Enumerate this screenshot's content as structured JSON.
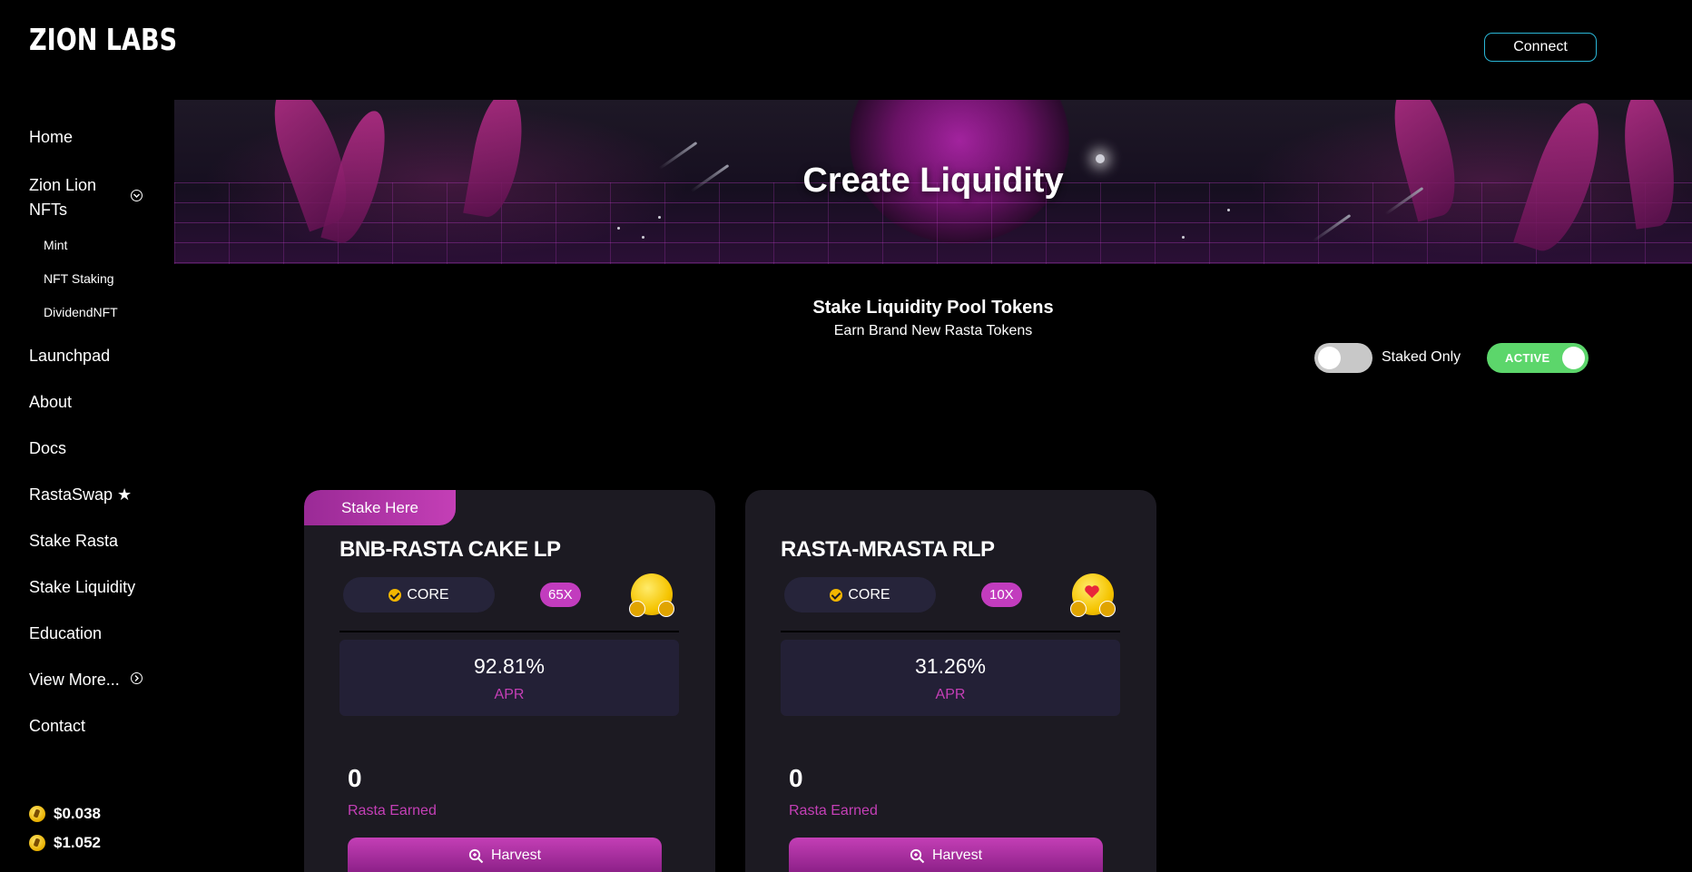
{
  "brand": "ZION LABS",
  "connect_label": "Connect",
  "sidebar": {
    "items": [
      {
        "label": "Home"
      },
      {
        "label": "Zion Lion NFTs",
        "line1": "Zion Lion",
        "line2": "NFTs"
      },
      {
        "label": "Mint"
      },
      {
        "label": "NFT Staking"
      },
      {
        "label": "DividendNFT"
      },
      {
        "label": "Launchpad"
      },
      {
        "label": "About"
      },
      {
        "label": "Docs"
      },
      {
        "label": "RastaSwap ★"
      },
      {
        "label": "Stake Rasta"
      },
      {
        "label": "Stake Liquidity"
      },
      {
        "label": "Education"
      },
      {
        "label": "View More..."
      },
      {
        "label": "Contact"
      }
    ],
    "prices": [
      "$0.038",
      "$1.052"
    ]
  },
  "banner": {
    "title": "Create Liquidity"
  },
  "section": {
    "title": "Stake Liquidity Pool Tokens",
    "subtitle": "Earn Brand New Rasta Tokens"
  },
  "filters": {
    "staked_only_label": "Staked Only",
    "active_label": "ACTIVE"
  },
  "cards": [
    {
      "tab": "Stake Here",
      "title": "BNB-RASTA CAKE LP",
      "core": "CORE",
      "multiplier": "65X",
      "apr_value": "92.81%",
      "apr_label": "APR",
      "earned_value": "0",
      "earned_label": "Rasta Earned",
      "harvest_label": "Harvest"
    },
    {
      "title": "RASTA-MRASTA RLP",
      "core": "CORE",
      "multiplier": "10X",
      "apr_value": "31.26%",
      "apr_label": "APR",
      "earned_value": "0",
      "earned_label": "Rasta Earned",
      "harvest_label": "Harvest"
    }
  ],
  "colors": {
    "accent": "#c43fb6",
    "connect_border": "#2ab6d6",
    "active_green": "#5cd66b",
    "card_bg": "#1c1a22"
  }
}
